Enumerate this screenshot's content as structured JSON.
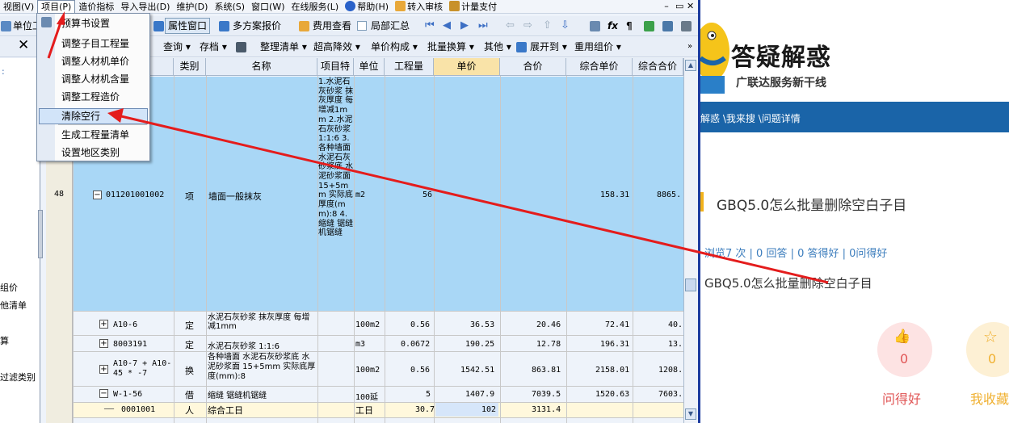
{
  "menubar": {
    "items": [
      "视图(V)",
      "项目(P)",
      "造价指标",
      "导入导出(D)",
      "维护(D)",
      "系统(S)",
      "窗口(W)",
      "在线服务(L)",
      "帮助(H)",
      "转入审核",
      "计量支付"
    ],
    "win_controls": [
      "–",
      "▭",
      "✕"
    ]
  },
  "toolbar1": {
    "left_label": "单位工",
    "attr_window": "属性窗口",
    "multi_quote": "多方案报价",
    "fee_view": "费用查看",
    "local_summary": "局部汇总"
  },
  "toolbar2": {
    "items": [
      "查询 ▾",
      "存档 ▾",
      "整理清单 ▾",
      "超高降效 ▾",
      "单价构成 ▾",
      "批量换算 ▾",
      "其他 ▾",
      "展开到 ▾",
      "重用组价 ▾"
    ]
  },
  "left_panel": {
    "items": [
      "组价",
      "他清单",
      "算",
      "过滤类别"
    ]
  },
  "dropdown": {
    "items": [
      "预算书设置",
      "调整子目工程量",
      "调整人材机单价",
      "调整人材机含量",
      "调整工程造价",
      "清除空行",
      "生成工程量清单",
      "设置地区类别"
    ]
  },
  "grid": {
    "headers": [
      "类别",
      "名称",
      "项目特",
      "单位",
      "工程量",
      "单价",
      "合价",
      "综合单价",
      "综合合价"
    ],
    "row48": {
      "num": "48",
      "code": "011201001002",
      "type": "项",
      "name": "墙面一般抹灰",
      "desc": "1.水泥石灰砂浆 抹灰厚度 每增减1mm 2.水泥石灰砂浆 1:1:6 3.各种墙面 水泥石灰砂浆底 水泥砂浆面 15+5mm 实际底厚度(mm):8 4.缩缝 锯缝机锯缝",
      "unit": "m2",
      "qty": "56",
      "unit_price": "",
      "total": "",
      "comp_price": "158.31",
      "comp_total": "8865."
    },
    "rows": [
      {
        "code": "A10-6",
        "type": "定",
        "name": "水泥石灰砂浆 抹灰厚度 每增减1mm",
        "unit": "100m2",
        "qty": "0.56",
        "price": "36.53",
        "total": "20.46",
        "comp": "72.41",
        "comp_total": "40."
      },
      {
        "code": "8003191",
        "type": "定",
        "name": "水泥石灰砂浆 1:1:6",
        "unit": "m3",
        "qty": "0.0672",
        "price": "190.25",
        "total": "12.78",
        "comp": "196.31",
        "comp_total": "13."
      },
      {
        "code": "A10-7 + A10-45 * -7",
        "type": "换",
        "name": "各种墙面 水泥石灰砂浆底 水泥砂浆面 15+5mm 实际底厚度(mm):8",
        "unit": "100m2",
        "qty": "0.56",
        "price": "1542.51",
        "total": "863.81",
        "comp": "2158.01",
        "comp_total": "1208."
      },
      {
        "code": "W-1-56",
        "type": "借",
        "name": "缩缝 锯缝机锯缝",
        "unit": "100延",
        "qty": "5",
        "price": "1407.9",
        "total": "7039.5",
        "comp": "1520.63",
        "comp_total": "7603."
      },
      {
        "code": "0001001",
        "type": "人",
        "name": "综合工日",
        "unit": "工日",
        "qty": "30.7",
        "price": "102",
        "total": "3131.4",
        "comp": "",
        "comp_total": ""
      }
    ]
  },
  "web": {
    "logo_title": "答疑解惑",
    "logo_sub": "广联达服务新干线",
    "breadcrumb": "解惑 \\我来搜 \\问题详情",
    "question_title": "GBQ5.0怎么批量删除空白子目",
    "stats": "浏览7 次 | 0 回答 | 0 答得好 | 0问得好",
    "body": "GBQ5.0怎么批量删除空白子目",
    "good_count": "0",
    "good_label": "问得好",
    "fav_count": "0",
    "fav_label": "我收藏"
  },
  "colors": {
    "accent_blue": "#1a64a8",
    "arrow_red": "#e41c1c",
    "selection_blue": "#a9d7f6",
    "header_highlight": "#f9e3a8"
  }
}
